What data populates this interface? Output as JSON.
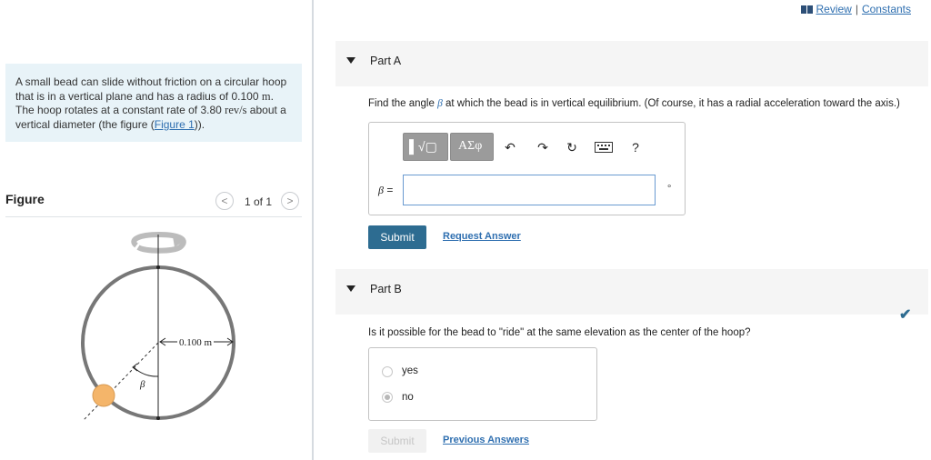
{
  "header": {
    "review_label": "Review",
    "separator": "|",
    "constants_label": "Constants"
  },
  "problem": {
    "text_1": "A small bead can slide without friction on a circular hoop that is in a vertical plane and has a radius of 0.100 ",
    "unit_m": "m",
    "text_2": ". The hoop rotates at a constant rate of 3.80 ",
    "unit_rev": "rev/s",
    "text_3": " about a vertical diameter (the figure (",
    "figure_link": "Figure 1",
    "text_4": "))."
  },
  "figure": {
    "label": "Figure",
    "counter": "1 of 1",
    "radius_label": "0.100 m",
    "angle_label": "β"
  },
  "part_a": {
    "title": "Part A",
    "question_1": "Find the angle ",
    "question_symbol": "β",
    "question_2": " at which the bead is in vertical equilibrium. (Of course, it has a radial acceleration toward the axis.)",
    "toolbar": {
      "templates": "▌√▢",
      "greek": "ΑΣφ",
      "help": "?"
    },
    "input_label_symbol": "β",
    "input_label_eq": " =",
    "input_value": "",
    "unit": "∘",
    "submit_label": "Submit",
    "request_answer_label": "Request Answer"
  },
  "part_b": {
    "title": "Part B",
    "question": "Is it possible for the bead to \"ride\" at the same elevation as the center of the hoop?",
    "options": [
      "yes",
      "no"
    ],
    "selected": "no",
    "submit_label": "Submit",
    "previous_answers_label": "Previous Answers"
  },
  "colors": {
    "accent": "#2d6c91",
    "link": "#2f6fb0",
    "problem_bg": "#e8f3f8",
    "bead": "#f4b56a"
  }
}
